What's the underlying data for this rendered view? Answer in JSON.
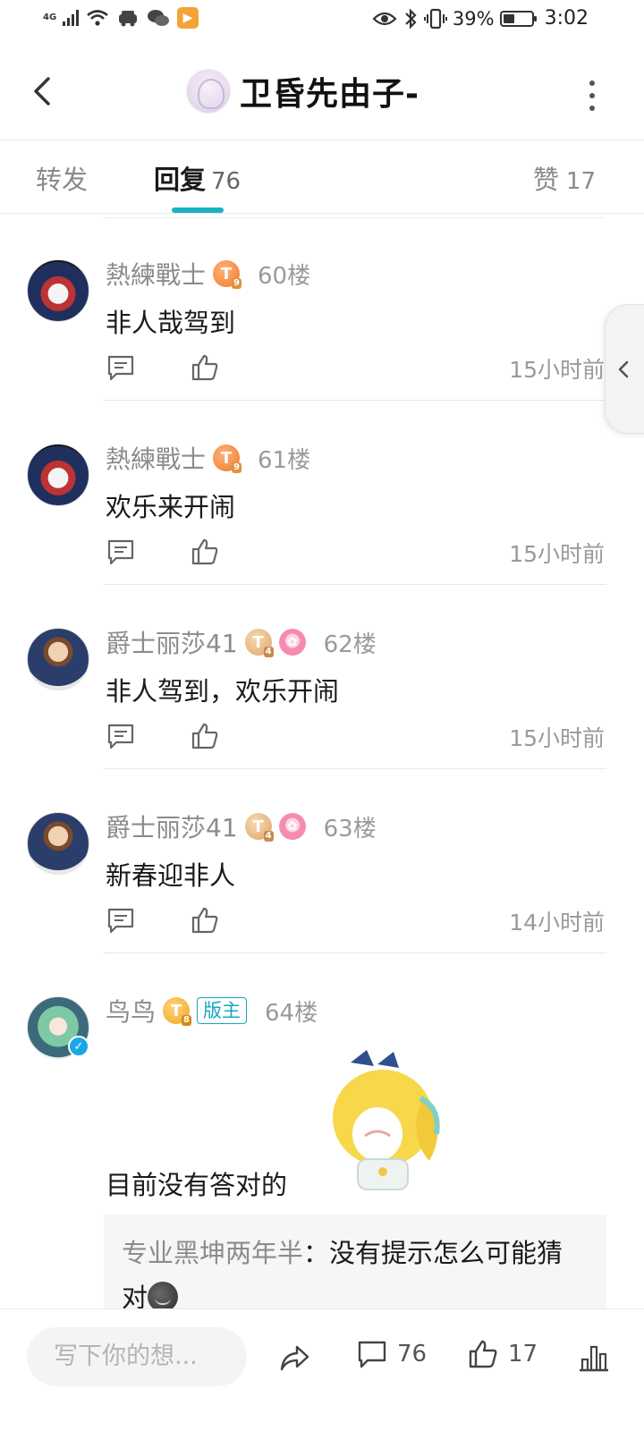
{
  "status_bar": {
    "network": "4G",
    "app_badge": "▶",
    "battery_percent": "39%",
    "battery_level": 0.39,
    "time": "3:02"
  },
  "nav": {
    "title": "卫昏先由子-"
  },
  "tabs": {
    "repost": "转发",
    "reply": "回复",
    "reply_count": "76",
    "like": "赞",
    "like_count": "17"
  },
  "comments": [
    {
      "user": "熱練戰士",
      "level": "T",
      "level_sub": "9",
      "floor": "60楼",
      "text": "非人哉驾到",
      "time": "15小时前"
    },
    {
      "user": "熱練戰士",
      "level": "T",
      "level_sub": "9",
      "floor": "61楼",
      "text": "欢乐来开闹",
      "time": "15小时前"
    },
    {
      "user": "爵士丽莎41",
      "level": "T",
      "level_sub": "4",
      "floor": "62楼",
      "text": "非人驾到，欢乐开闹",
      "time": "15小时前"
    },
    {
      "user": "爵士丽莎41",
      "level": "T",
      "level_sub": "4",
      "floor": "63楼",
      "text": "新春迎非人",
      "time": "14小时前"
    },
    {
      "user": "鸟鸟",
      "level": "T",
      "level_sub": "8",
      "mod_badge": "版主",
      "floor": "64楼",
      "text": "目前没有答对的",
      "quote_name": "专业黑坤两年半",
      "quote_text": "：没有提示怎么可能猜对"
    }
  ],
  "bottom_bar": {
    "input_placeholder": "写下你的想...",
    "comment_count": "76",
    "like_count": "17"
  },
  "colors": {
    "accent": "#17b3c3",
    "mod_badge": "#17a7bd",
    "level_orange": "#f07a2a",
    "level_gold": "#f0a81e",
    "level_tan": "#dca56a",
    "medal_pink": "#f58bb0",
    "verified": "#1aa7e8"
  },
  "icons": [
    "signal-icon",
    "wifi-icon",
    "eye-icon",
    "bluetooth-icon",
    "vibrate-icon",
    "battery-icon",
    "back-icon",
    "more-icon",
    "comment-icon",
    "like-icon",
    "share-icon",
    "rank-icon",
    "chevron-left-icon"
  ]
}
